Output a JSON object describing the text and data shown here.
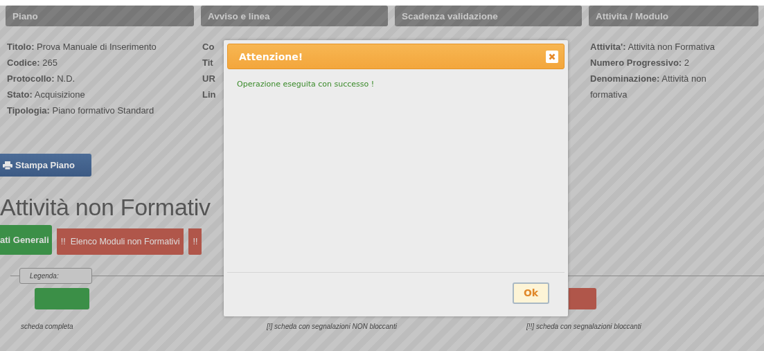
{
  "panels": [
    {
      "title": "Piano",
      "fields": [
        {
          "label": "Titolo:",
          "value": "Prova Manuale di Inserimento"
        },
        {
          "label": "Codice:",
          "value": "265"
        },
        {
          "label": "Protocollo:",
          "value": "N.D."
        },
        {
          "label": "Stato:",
          "value": "Acquisizione"
        },
        {
          "label": "Tipologia:",
          "value": "Piano formativo Standard"
        }
      ]
    },
    {
      "title": "Avviso e linea",
      "fields": [
        {
          "label": "Co"
        },
        {
          "label": "Tit"
        },
        {
          "label": "UR"
        },
        {
          "label": "Lin"
        }
      ]
    },
    {
      "title": "Scadenza validazione"
    },
    {
      "title": "Attivita / Modulo",
      "fields": [
        {
          "label": "Attivita':",
          "value": "Attività non Formativa"
        },
        {
          "label": "Numero Progressivo:",
          "value": "2"
        },
        {
          "label": "Denominazione:",
          "value": "Attività non formativa"
        }
      ]
    }
  ],
  "print_button": "Stampa Piano",
  "heading": "Attività non Formativ",
  "tabs": [
    {
      "label": "ati Generali",
      "color": "#3b8f47",
      "selected": true
    },
    {
      "label": "!!  Elenco Moduli non Formativi",
      "color": "#b0564a",
      "selected": false
    },
    {
      "label": "!!",
      "color": "#b0564a",
      "selected": false
    }
  ],
  "legend": {
    "title": "Legenda:",
    "items": [
      {
        "kind": "complete",
        "color": "#3b8f47",
        "label": "scheda completa"
      },
      {
        "kind": "warning",
        "label": "[!] scheda con segnalazioni NON bloccanti"
      },
      {
        "kind": "blocking",
        "color": "#b0564a",
        "label": "[!!] scheda con segnalazioni bloccanti"
      }
    ]
  },
  "dialog": {
    "title": "Attenzione!",
    "message": "Operazione eseguita con successo !",
    "ok_button": "Ok"
  }
}
